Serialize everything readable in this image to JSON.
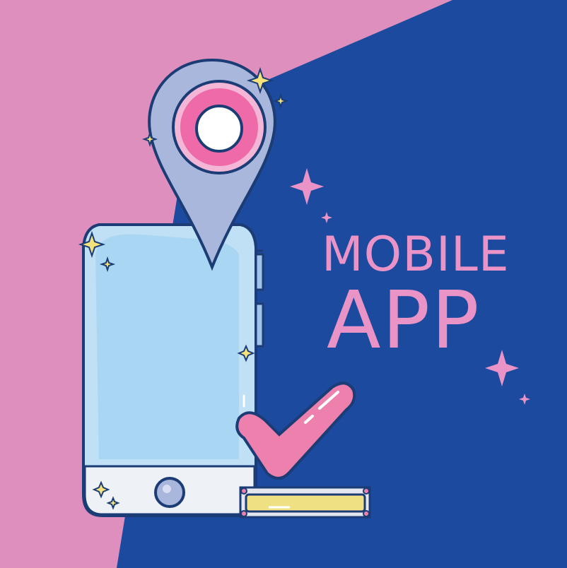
{
  "title": {
    "line1": "MOBILE",
    "line2": "APP"
  },
  "colors": {
    "pink_bg": "#de8fbd",
    "navy_bg": "#1c4a9e",
    "accent_pink": "#e993c7",
    "phone_body": "#bfe0f5",
    "pin_fill": "#a9b7dd",
    "check_pink": "#ee80ad",
    "sparkle_yellow": "#f5e27a",
    "bar_yellow": "#efe083",
    "outline": "#1b3c75"
  },
  "icons": [
    "location-pin-icon",
    "check-mark-icon",
    "sparkle-icon",
    "home-button-icon"
  ]
}
